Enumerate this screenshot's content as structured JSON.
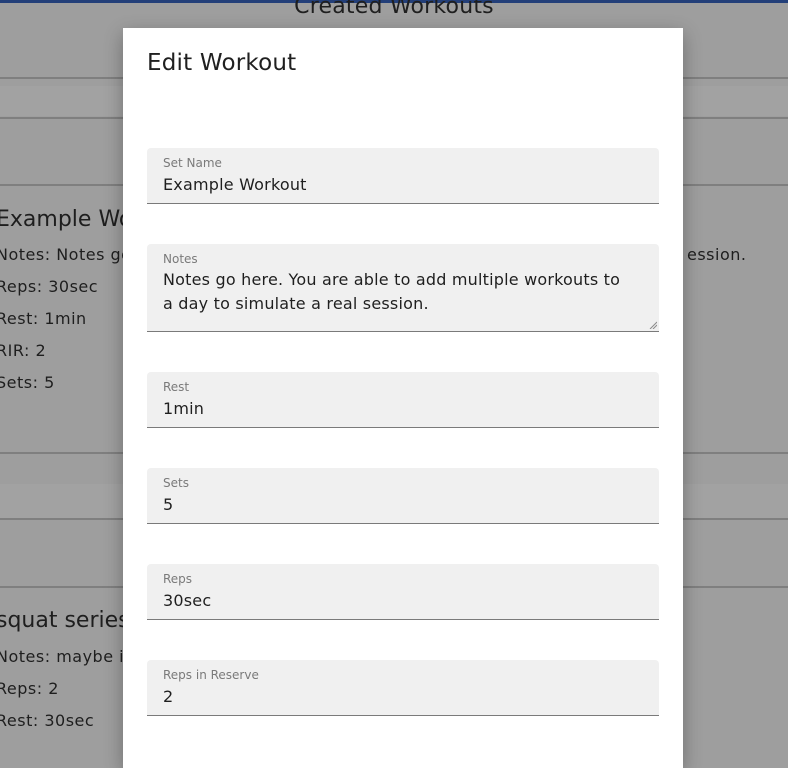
{
  "background": {
    "page_title": "Created Workouts",
    "cards": [
      {
        "title": "Example Wo",
        "lines": [
          "Notes: Notes go",
          "Reps: 30sec",
          "Rest: 1min",
          "RIR: 2",
          "Sets: 5"
        ],
        "notes_tail": "ession."
      },
      {
        "title": "squat series",
        "lines": [
          "Notes: maybe it v",
          "Reps: 2",
          "Rest: 30sec"
        ]
      }
    ]
  },
  "dialog": {
    "title": "Edit Workout",
    "fields": {
      "set_name": {
        "label": "Set Name",
        "value": "Example Workout"
      },
      "notes": {
        "label": "Notes",
        "value": "Notes go here. You are able to add multiple workouts to a day to simulate a real session."
      },
      "rest": {
        "label": "Rest",
        "value": "1min"
      },
      "sets": {
        "label": "Sets",
        "value": "5"
      },
      "reps": {
        "label": "Reps",
        "value": "30sec"
      },
      "rir": {
        "label": "Reps in Reserve",
        "value": "2"
      }
    }
  },
  "colors": {
    "topbar": "#233f79",
    "overlay": "#9e9e9e",
    "field_bg": "#f0f0f0"
  }
}
